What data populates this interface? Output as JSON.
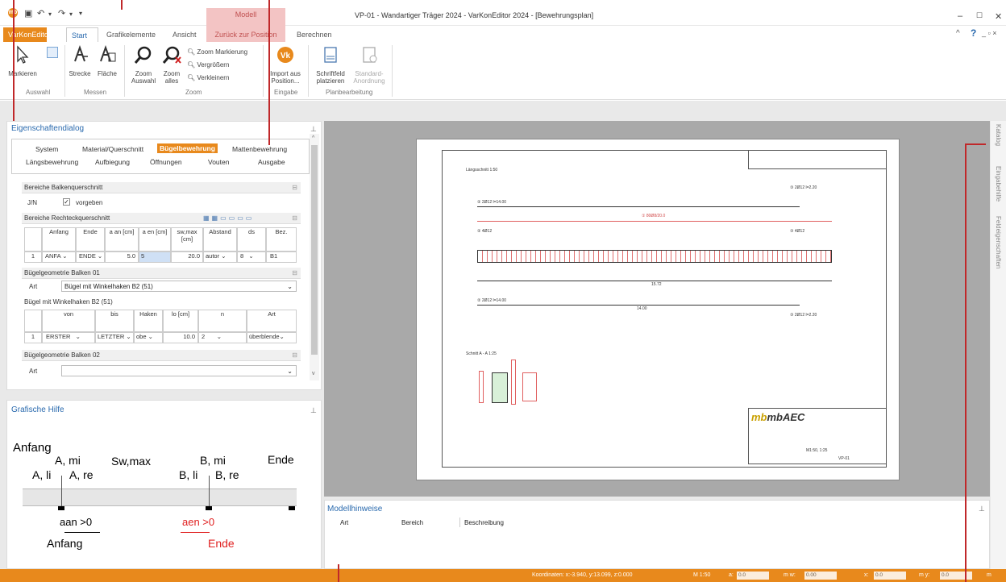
{
  "app": {
    "title": "VP-01 - Wandartiger Träger 2024 - VarKonEditor 2024 - [Bewehrungsplan]",
    "logo": "mb",
    "context_header": "Modell"
  },
  "tabs": [
    "VarKonEditor",
    "Start",
    "Grafikelemente",
    "Ansicht",
    "Zurück zur Position",
    "Berechnen"
  ],
  "ribbon": {
    "markieren": "Markieren",
    "strecke": "Strecke",
    "flaeche": "Fläche",
    "zoom_auswahl": "Zoom Auswahl",
    "zoom_alles": "Zoom alles",
    "zoom_markierung": "Zoom Markierung",
    "vergroessern": "Vergrößern",
    "verkleinern": "Verkleinern",
    "import": "Import aus Position...",
    "schriftfeld": "Schriftfeld platzieren",
    "standard": "Standard-Anordnung",
    "groups": [
      "Auswahl",
      "Messen",
      "Zoom",
      "Eingabe",
      "Planbearbeitung"
    ]
  },
  "props": {
    "title": "Eigenschaftendialog",
    "tabs_row1": [
      "System",
      "Material/Querschnitt",
      "Bügelbewehrung",
      "Mattenbewehrung"
    ],
    "tabs_row2": [
      "Längsbewehrung",
      "Aufbiegung",
      "Öffnungen",
      "Vouten",
      "Ausgabe"
    ],
    "sec1": "Bereiche Balkenquerschnitt",
    "jn": "J/N",
    "vorgeben": "vorgeben",
    "sec2": "Bereiche Rechteckquerschnitt",
    "t1_headers": [
      "Anfang",
      "Ende",
      "a an [cm]",
      "a en [cm]",
      "sw,max [cm]",
      "Abstand",
      "ds",
      "Bez."
    ],
    "t1_row": [
      "1",
      "ANFA",
      "ENDE",
      "5.0",
      "5",
      "20.0",
      "autor",
      "8",
      "B1"
    ],
    "sec3": "Bügelgeometrie Balken 01",
    "art": "Art",
    "art_value": "Bügel mit Winkelhaken B2 (51)",
    "sub": "Bügel mit Winkelhaken B2 (51)",
    "t2_headers": [
      "von",
      "bis",
      "Haken",
      "lo [cm]",
      "n",
      "Art"
    ],
    "t2_row": [
      "1",
      "ERSTER",
      "LETZTER",
      "obe",
      "10.0",
      "2",
      "überblende"
    ],
    "sec4": "Bügelgeometrie Balken 02",
    "art2": "Art"
  },
  "help": {
    "title": "Grafische Hilfe",
    "labels": [
      "Anfang",
      "A, mi",
      "A, li",
      "A, re",
      "Sw,max",
      "B, mi",
      "B, li",
      "B, re",
      "Ende",
      "aan >0",
      "Anfang",
      "aen >0",
      "Ende"
    ]
  },
  "drawing": {
    "laengsschnitt": "Längsschnitt 1:50",
    "bar1": "② 2Ø12 l=14.00",
    "bar3": "③ 2Ø12 l=2.20",
    "bar2": "② 4Ø12",
    "bar4": "③ 4Ø12",
    "stirrup": "① 80Ø8/20.0",
    "dim_total": "15.72",
    "dim_len": "14.00",
    "schnitt": "Schnitt A - A 1:25",
    "company": "mbAEC",
    "title_block": "M1:50, 1:25",
    "plan": "VP-01"
  },
  "hints": {
    "title": "Modellhinweise",
    "cols": [
      "Art",
      "Bereich",
      "Beschreibung"
    ]
  },
  "side_tabs": [
    "Katalog",
    "Eingabehilfe",
    "Feldeigenschaften"
  ],
  "status": {
    "coords": "Koordinaten: x:-3.940, y:13.099, z:0.000",
    "scale": "M 1:50",
    "a_label": "a:",
    "a_val": "0.0",
    "w_label": "m w:",
    "w_val": "0.00",
    "x_label": "x:",
    "x_val": "0.0",
    "y_label": "m y:",
    "y_val": "0.0",
    "m": "m"
  },
  "accent": "#e8891c"
}
